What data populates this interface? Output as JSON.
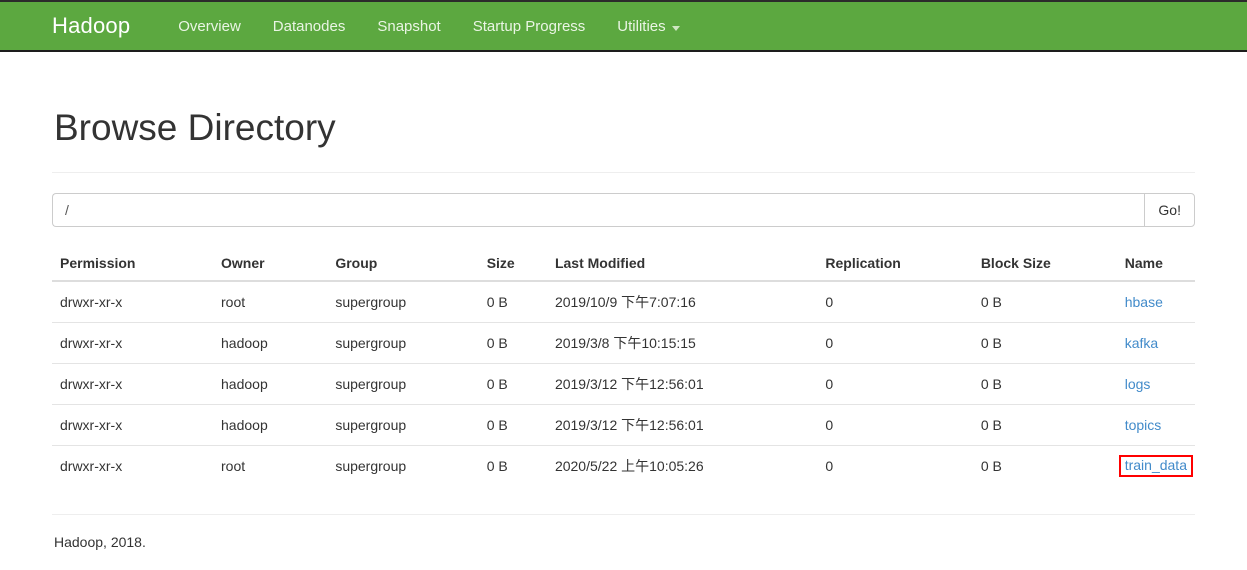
{
  "navbar": {
    "brand": "Hadoop",
    "items": [
      {
        "label": "Overview",
        "caret": false
      },
      {
        "label": "Datanodes",
        "caret": false
      },
      {
        "label": "Snapshot",
        "caret": false
      },
      {
        "label": "Startup Progress",
        "caret": false
      },
      {
        "label": "Utilities",
        "caret": true
      }
    ],
    "background_color": "#5ca840"
  },
  "page": {
    "title": "Browse Directory"
  },
  "search": {
    "value": "/",
    "placeholder": "",
    "go_label": "Go!"
  },
  "table": {
    "headers": [
      "Permission",
      "Owner",
      "Group",
      "Size",
      "Last Modified",
      "Replication",
      "Block Size",
      "Name"
    ],
    "rows": [
      {
        "permission": "drwxr-xr-x",
        "owner": "root",
        "group": "supergroup",
        "size": "0 B",
        "modified": "2019/10/9 下午7:07:16",
        "replication": "0",
        "block_size": "0 B",
        "name": "hbase",
        "highlighted": false
      },
      {
        "permission": "drwxr-xr-x",
        "owner": "hadoop",
        "group": "supergroup",
        "size": "0 B",
        "modified": "2019/3/8 下午10:15:15",
        "replication": "0",
        "block_size": "0 B",
        "name": "kafka",
        "highlighted": false
      },
      {
        "permission": "drwxr-xr-x",
        "owner": "hadoop",
        "group": "supergroup",
        "size": "0 B",
        "modified": "2019/3/12 下午12:56:01",
        "replication": "0",
        "block_size": "0 B",
        "name": "logs",
        "highlighted": false
      },
      {
        "permission": "drwxr-xr-x",
        "owner": "hadoop",
        "group": "supergroup",
        "size": "0 B",
        "modified": "2019/3/12 下午12:56:01",
        "replication": "0",
        "block_size": "0 B",
        "name": "topics",
        "highlighted": false
      },
      {
        "permission": "drwxr-xr-x",
        "owner": "root",
        "group": "supergroup",
        "size": "0 B",
        "modified": "2020/5/22 上午10:05:26",
        "replication": "0",
        "block_size": "0 B",
        "name": "train_data",
        "highlighted": true
      }
    ],
    "link_color": "#428bca",
    "highlight_color": "#ff0000"
  },
  "footer": {
    "text": "Hadoop, 2018."
  }
}
